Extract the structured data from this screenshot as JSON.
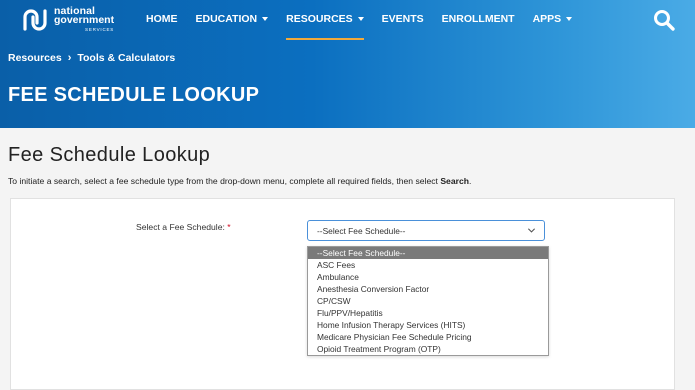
{
  "brand": {
    "line1": "national",
    "line2": "government",
    "line3": "SERVICES"
  },
  "nav": [
    {
      "label": "HOME",
      "dropdown": false,
      "active": false
    },
    {
      "label": "EDUCATION",
      "dropdown": true,
      "active": false
    },
    {
      "label": "RESOURCES",
      "dropdown": true,
      "active": true
    },
    {
      "label": "EVENTS",
      "dropdown": false,
      "active": false
    },
    {
      "label": "ENROLLMENT",
      "dropdown": false,
      "active": false
    },
    {
      "label": "APPS",
      "dropdown": true,
      "active": false
    }
  ],
  "breadcrumb": {
    "items": [
      "Resources",
      "Tools & Calculators"
    ],
    "separator": "›"
  },
  "banner": {
    "title": "FEE SCHEDULE LOOKUP"
  },
  "content": {
    "title": "Fee Schedule Lookup",
    "instructions_prefix": "To initiate a search, select a fee schedule type from the drop-down menu, complete all required fields, then select ",
    "instructions_bold": "Search",
    "instructions_suffix": "."
  },
  "form": {
    "label": "Select a Fee Schedule:",
    "required_marker": "*",
    "select_value": "--Select Fee Schedule--",
    "options": [
      "--Select Fee Schedule--",
      "ASC Fees",
      "Ambulance",
      "Anesthesia Conversion Factor",
      "CP/CSW",
      "Flu/PPV/Hepatitis",
      "Home Infusion Therapy Services (HITS)",
      "Medicare Physician Fee Schedule Pricing",
      "Opioid Treatment Program (OTP)"
    ],
    "selected_index": 0
  },
  "colors": {
    "header_start": "#0a5fa8",
    "header_end": "#4aabe6",
    "active_underline": "#f2a93b",
    "focus_border": "#4a90d9",
    "required": "#d0021b"
  }
}
